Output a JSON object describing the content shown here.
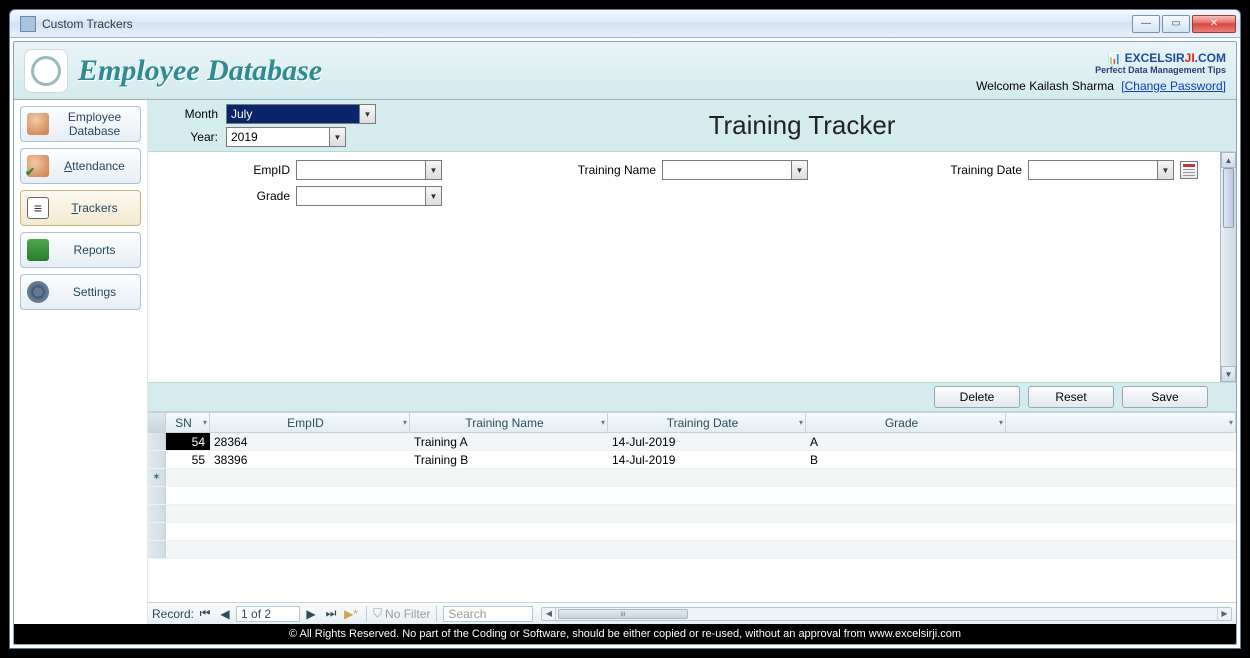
{
  "window": {
    "title": "Custom Trackers"
  },
  "brand": {
    "title": "Employee Database",
    "logo_text1": "EXCELSIR",
    "logo_text2": "JI",
    "logo_text3": ".COM",
    "logo_sub": "Perfect Data Management Tips",
    "welcome_prefix": "Welcome ",
    "welcome_user": "Kailash Sharma",
    "change_pwd": "[Change Password]"
  },
  "sidebar": {
    "items": [
      {
        "label": "Employee Database",
        "key": "employee-database"
      },
      {
        "label": "Attendance",
        "key": "attendance",
        "underline_first": true
      },
      {
        "label": "Trackers",
        "key": "trackers",
        "underline_first": true
      },
      {
        "label": "Reports",
        "key": "reports"
      },
      {
        "label": "Settings",
        "key": "settings"
      }
    ]
  },
  "form": {
    "month_label": "Month",
    "month_value": "July",
    "year_label": "Year:",
    "year_value": "2019",
    "page_title": "Training Tracker",
    "empid_label": "EmpID",
    "grade_label": "Grade",
    "training_name_label": "Training Name",
    "training_date_label": "Training Date"
  },
  "buttons": {
    "delete": "Delete",
    "reset": "Reset",
    "save": "Save"
  },
  "grid": {
    "headers": {
      "sn": "SN",
      "empid": "EmpID",
      "tn": "Training Name",
      "td": "Training Date",
      "gr": "Grade"
    },
    "rows": [
      {
        "sn": "54",
        "emp": "28364",
        "tn": "Training A",
        "td": "14-Jul-2019",
        "gr": "A"
      },
      {
        "sn": "55",
        "emp": "38396",
        "tn": "Training B",
        "td": "14-Jul-2019",
        "gr": "B"
      }
    ]
  },
  "recnav": {
    "label": "Record:",
    "position": "1 of 2",
    "nofilter": "No Filter",
    "search_placeholder": "Search"
  },
  "footer": "© All Rights Reserved. No part of the Coding or Software, should be either copied or re-used, without an approval from www.excelsirji.com"
}
